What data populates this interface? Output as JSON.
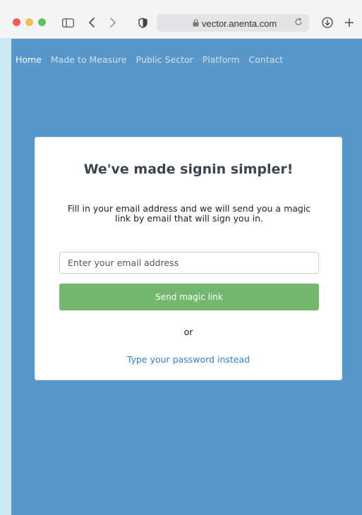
{
  "browser": {
    "url": "vector.anenta.com",
    "icons": [
      "close-window",
      "minimize-window",
      "maximize-window",
      "sidebar-icon",
      "back-icon",
      "forward-icon",
      "shield-icon",
      "lock-icon",
      "reload-icon",
      "download-icon",
      "new-tab-icon"
    ]
  },
  "nav": {
    "items": [
      "Home",
      "Made to Measure",
      "Public Sector",
      "Platform",
      "Contact"
    ],
    "active": "Home"
  },
  "signin": {
    "title": "We've made signin simpler!",
    "description": "Fill in your email address and we will send you a magic link by email that will sign you in.",
    "email_placeholder": "Enter your email address",
    "email_value": "",
    "button_label": "Send magic link",
    "or_text": "or",
    "password_link": "Type your password instead"
  },
  "colors": {
    "page_background": "#5897c9",
    "button_green": "#74b86f",
    "link_blue": "#2f7fd1",
    "heading": "#3d4451"
  }
}
